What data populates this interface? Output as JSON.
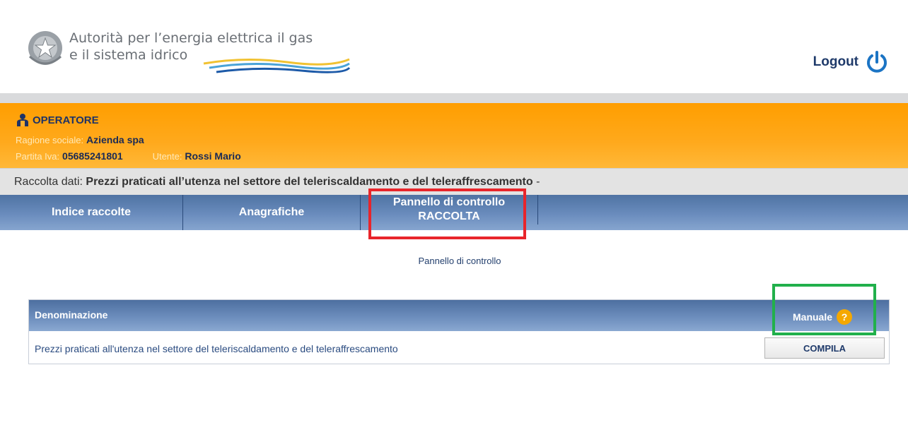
{
  "header": {
    "org_line1": "Autorità per l’energia elettrica il gas",
    "org_line2": "e il sistema idrico",
    "logout_label": "Logout",
    "logout_icon": "power-icon"
  },
  "operator": {
    "title": "OPERATORE",
    "ragione_sociale_label": "Ragione sociale:",
    "ragione_sociale_value": "Azienda spa",
    "partita_iva_label": "Partita Iva:",
    "partita_iva_value": "05685241801",
    "utente_label": "Utente:",
    "utente_value": "Rossi Mario"
  },
  "raccolta": {
    "label": "Raccolta dati:",
    "value": "Prezzi praticati all’utenza nel settore del teleriscaldamento e del teleraffrescamento",
    "suffix": "-"
  },
  "nav": {
    "items": [
      {
        "label": "Indice raccolte"
      },
      {
        "label": "Anagrafiche"
      },
      {
        "label_line1": "Pannello di controllo",
        "label_line2": "RACCOLTA"
      }
    ]
  },
  "breadcrumb": "Pannello di controllo",
  "table": {
    "col_denominazione": "Denominazione",
    "col_manuale": "Manuale",
    "help_glyph": "?",
    "rows": [
      {
        "denominazione": "Prezzi praticati all'utenza nel settore del teleriscaldamento e del teleraffrescamento",
        "action": "COMPILA"
      }
    ]
  },
  "colors": {
    "orange": "#ff9e00",
    "nav_blue": "#5f82b3",
    "highlight_red": "#e8252b",
    "highlight_green": "#21b04b"
  }
}
